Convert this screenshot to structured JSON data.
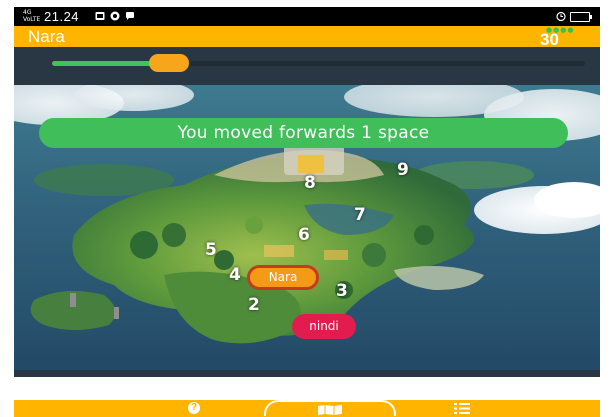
{
  "status_bar": {
    "network": "4G\nVoLTE",
    "time": "21.24",
    "notification_icons": [
      "gallery-icon",
      "whatsapp-icon",
      "chat-icon"
    ],
    "right_icons": [
      "alarm-icon",
      "battery-icon"
    ]
  },
  "header": {
    "player_name": "Nara",
    "score": "30",
    "score_dots": "●●●●"
  },
  "progress": {
    "fraction": 0.22
  },
  "toast": {
    "message": "You moved forwards 1 space"
  },
  "board": {
    "squares": [
      {
        "label": "2"
      },
      {
        "label": "3"
      },
      {
        "label": "4"
      },
      {
        "label": "5"
      },
      {
        "label": "6"
      },
      {
        "label": "7"
      },
      {
        "label": "8"
      },
      {
        "label": "9"
      }
    ],
    "tokens": {
      "nara": "Nara",
      "nindi": "nindi"
    }
  },
  "nav": {
    "help_icon": "question-icon",
    "help_glyph": "?",
    "map_icon": "map-icon",
    "list_icon": "list-icon"
  },
  "colors": {
    "accent": "#ffb400",
    "toast": "#3fbe5a",
    "progress_fill": "#3fc35a",
    "progress_knob": "#f7a51a",
    "nara_token": "#f59a16",
    "nindi_token": "#e21c4e",
    "background_dark": "#283743"
  }
}
